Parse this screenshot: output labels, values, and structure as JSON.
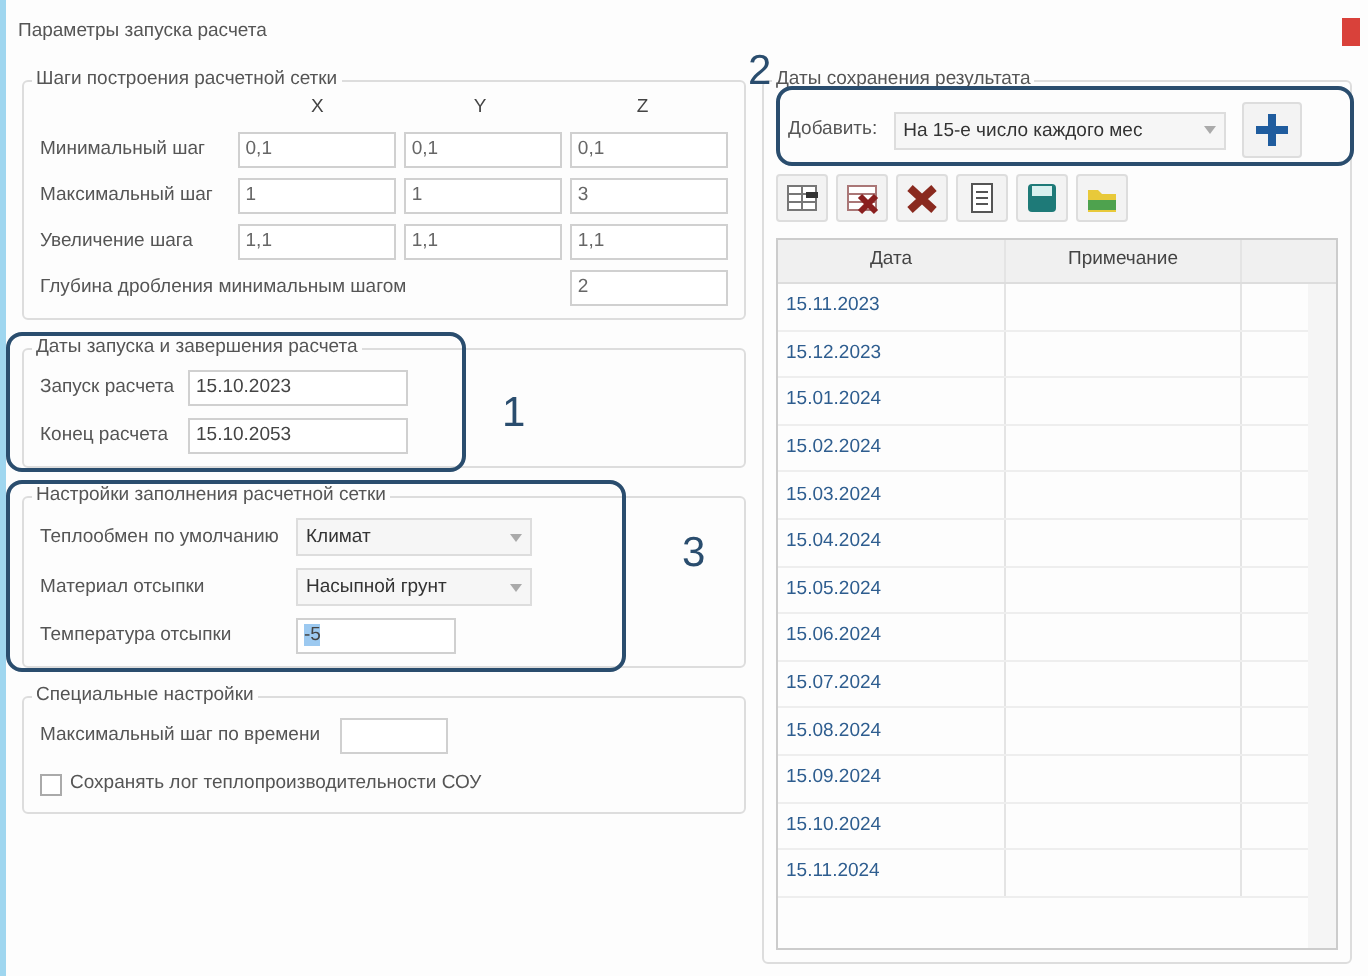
{
  "window": {
    "title": "Параметры запуска расчета"
  },
  "grid_steps": {
    "legend": "Шаги построения расчетной сетки",
    "axes": [
      "X",
      "Y",
      "Z"
    ],
    "rows": [
      {
        "label": "Минимальный шаг",
        "values": [
          "0,1",
          "0,1",
          "0,1"
        ]
      },
      {
        "label": "Максимальный шаг",
        "values": [
          "1",
          "1",
          "3"
        ]
      },
      {
        "label": "Увеличение шага",
        "values": [
          "1,1",
          "1,1",
          "1,1"
        ]
      }
    ],
    "depth": {
      "label": "Глубина дробления минимальным шагом",
      "value": "2"
    }
  },
  "dates": {
    "legend": "Даты запуска и завершения расчета",
    "fields": [
      {
        "label": "Запуск расчета",
        "value": "15.10.2023"
      },
      {
        "label": "Конец расчета",
        "value": "15.10.2053"
      }
    ]
  },
  "fill": {
    "legend": "Настройки заполнения расчетной сетки",
    "fields": [
      {
        "kind": "select",
        "label": "Теплообмен по умолчанию",
        "value": "Климат"
      },
      {
        "kind": "select",
        "label": "Материал отсыпки",
        "value": "Насыпной грунт"
      },
      {
        "kind": "text",
        "label": "Температура отсыпки",
        "value": "-5",
        "text_selected": true
      }
    ]
  },
  "special": {
    "legend": "Специальные настройки",
    "time_step": {
      "label": "Максимальный шаг по времени"
    },
    "log_checkbox": {
      "label": "Сохранять лог теплопроизводительности СОУ",
      "checked": false
    }
  },
  "save_dates": {
    "legend": "Даты сохранения результата",
    "add_label": "Добавить:",
    "add_select": "На 15-е число каждого мес",
    "columns": [
      "Дата",
      "Примечание"
    ],
    "rows": [
      "15.11.2023",
      "15.12.2023",
      "15.01.2024",
      "15.02.2024",
      "15.03.2024",
      "15.04.2024",
      "15.05.2024",
      "15.06.2024",
      "15.07.2024",
      "15.08.2024",
      "15.09.2024",
      "15.10.2024",
      "15.11.2024"
    ]
  },
  "callouts": [
    {
      "number": "1"
    },
    {
      "number": "2"
    },
    {
      "number": "3"
    }
  ]
}
